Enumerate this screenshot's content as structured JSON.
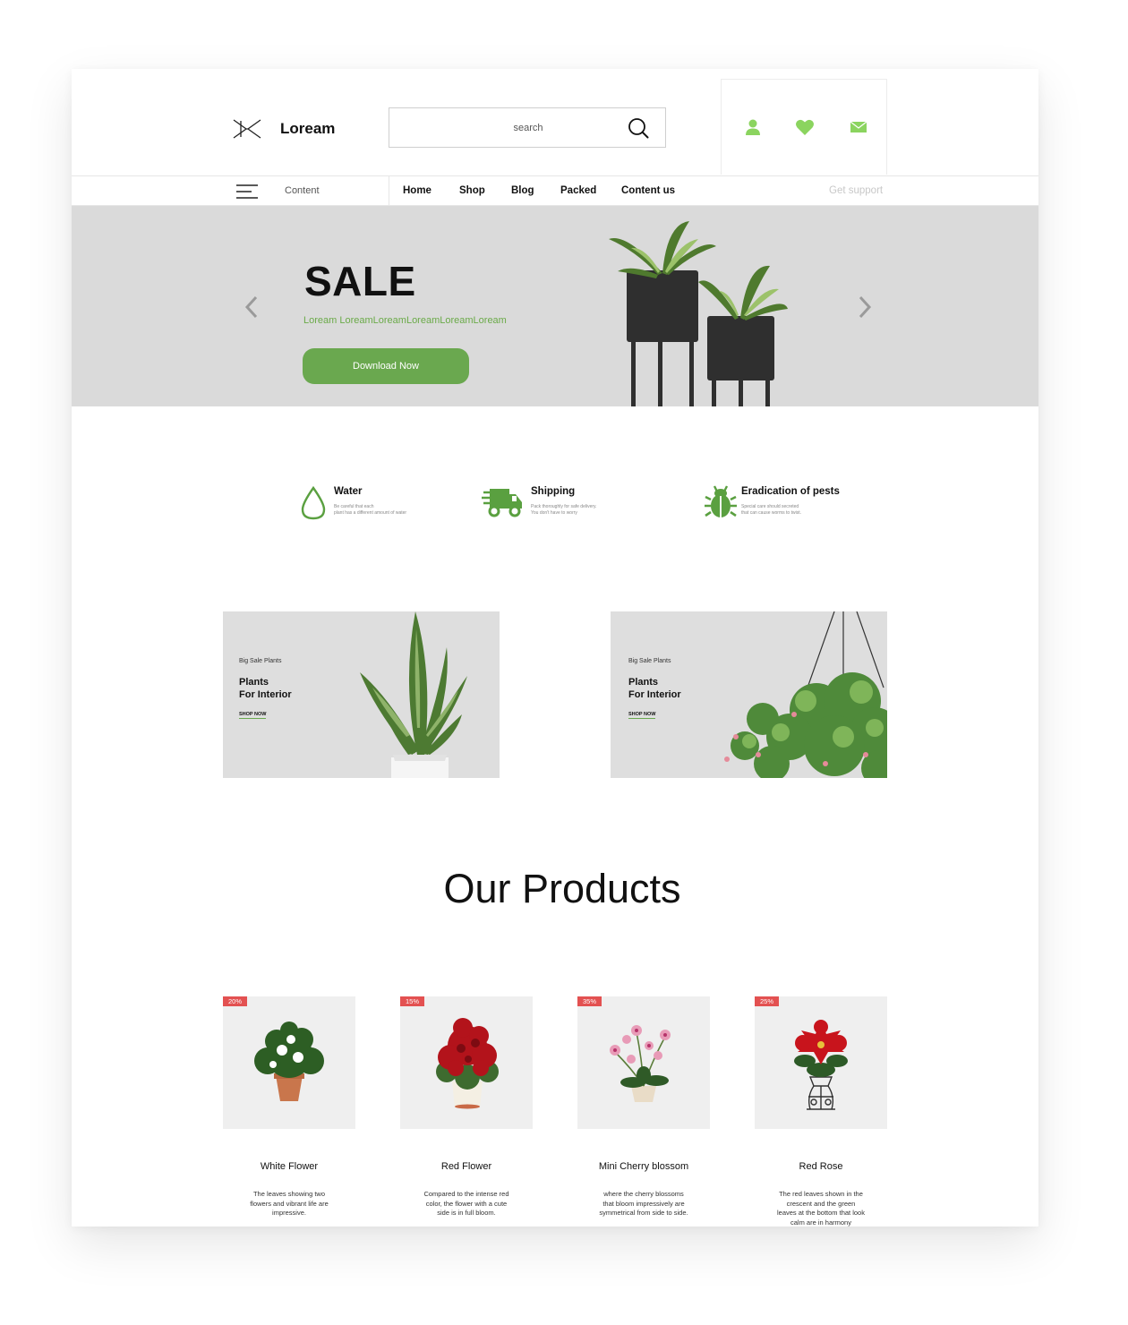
{
  "header": {
    "brand": "Loream",
    "search_placeholder": "search",
    "icons": [
      "user-icon",
      "heart-icon",
      "mail-icon"
    ]
  },
  "nav": {
    "content_label": "Content",
    "links": [
      "Home",
      "Shop",
      "Blog",
      "Packed",
      "Content us"
    ],
    "support": "Get support"
  },
  "hero": {
    "title": "SALE",
    "subtitle": "Loream LoreamLoreamLoreamLoreamLoream",
    "cta": "Download Now"
  },
  "features": [
    {
      "title": "Water",
      "desc_1": "Be careful that each",
      "desc_2": "plant has a different amount of water",
      "icon": "water-drop-icon"
    },
    {
      "title": "Shipping",
      "desc_1": "Pack thoroughly for safe delivery.",
      "desc_2": "You don't have to worry",
      "icon": "truck-icon"
    },
    {
      "title": "Eradication of pests",
      "desc_1": "Special care should secreted",
      "desc_2": "that can cause worms to twist.",
      "icon": "bug-icon"
    }
  ],
  "promos": [
    {
      "kicker": "Big Sale Plants",
      "title_1": "Plants",
      "title_2": "For Interior",
      "link": "SHOP NOW"
    },
    {
      "kicker": "Big Sale Plants",
      "title_1": "Plants",
      "title_2": "For Interior",
      "link": "SHOP NOW"
    }
  ],
  "products_heading": "Our Products",
  "products": [
    {
      "name": "White Flower",
      "discount": "20%",
      "desc": "The leaves showing two flowers and vibrant life are impressive."
    },
    {
      "name": "Red Flower",
      "discount": "15%",
      "desc": "Compared to the intense red color, the flower with a cute side is in full bloom."
    },
    {
      "name": "Mini Cherry blossom",
      "discount": "35%",
      "desc": "where the cherry blossoms that bloom impressively are symmetrical from side to side."
    },
    {
      "name": "Red Rose",
      "discount": "25%",
      "desc": "The red leaves shown in the crescent and the green leaves at the bottom that look calm are in harmony"
    }
  ],
  "colors": {
    "accent_green": "#6aa84f",
    "badge_red": "#e35151",
    "hero_bg": "#dadada"
  }
}
